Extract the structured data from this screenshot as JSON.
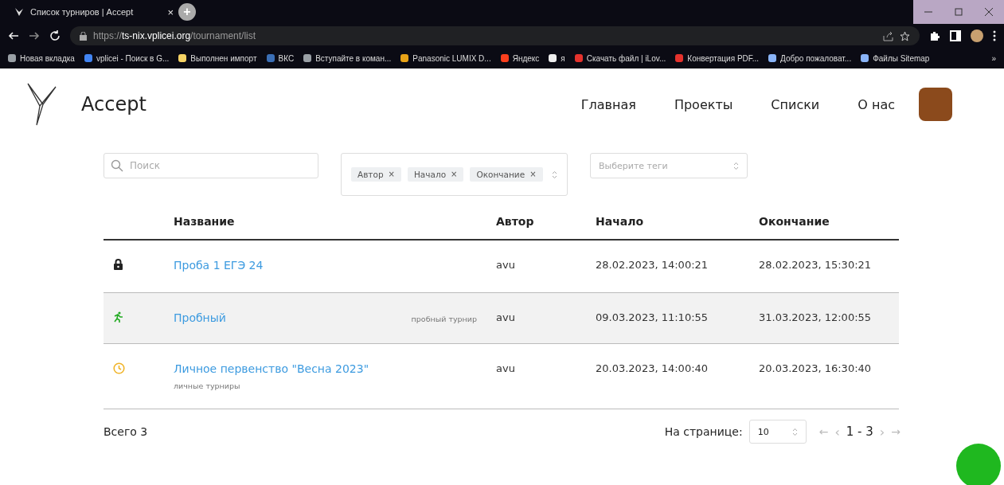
{
  "browser": {
    "tab_title": "Список турниров | Accept",
    "tab_close": "×",
    "new_tab": "+",
    "url_scheme": "https://",
    "url_host": "ts-nix.vplicei.org",
    "url_path": "/tournament/list",
    "bookmarks": [
      {
        "label": "Новая вкладка",
        "color": "#9aa0a6"
      },
      {
        "label": "vplicei - Поиск в G...",
        "color": "#4285f4"
      },
      {
        "label": "Выполнен импорт",
        "color": "#f6d365"
      },
      {
        "label": "ВКС",
        "color": "#3b6fb6"
      },
      {
        "label": "Вступайте в коман...",
        "color": "#9aa0a6"
      },
      {
        "label": "Panasonic LUMIX D...",
        "color": "#e8a317"
      },
      {
        "label": "Яндекс",
        "color": "#fc3f1d"
      },
      {
        "label": "я",
        "color": "#eeeeee"
      },
      {
        "label": "Скачать файл | iLov...",
        "color": "#e5322d"
      },
      {
        "label": "Конвертация PDF...",
        "color": "#e5322d"
      },
      {
        "label": "Добро пожаловат...",
        "color": "#8ab4f8"
      },
      {
        "label": "Файлы Sitemap",
        "color": "#8ab4f8"
      }
    ],
    "more": "»"
  },
  "header": {
    "brand": "Accept",
    "nav": [
      {
        "label": "Главная"
      },
      {
        "label": "Проекты"
      },
      {
        "label": "Списки"
      },
      {
        "label": "О нас"
      }
    ]
  },
  "filters": {
    "search_placeholder": "Поиск",
    "columns": [
      {
        "label": "Автор",
        "remove": "×"
      },
      {
        "label": "Начало",
        "remove": "×"
      },
      {
        "label": "Окончание",
        "remove": "×"
      }
    ],
    "tags_placeholder": "Выберите теги"
  },
  "table": {
    "columns": [
      "Название",
      "Автор",
      "Начало",
      "Окончание"
    ],
    "rows": [
      {
        "kind": "lock",
        "color": "#222222",
        "name": "Проба 1 ЕГЭ 24",
        "author": "avu",
        "start": "28.02.2023, 14:00:21",
        "end": "28.02.2023, 15:30:21",
        "selected": false
      },
      {
        "kind": "running",
        "color": "#22aa22",
        "name": "Пробный",
        "tag": "пробный турнир",
        "author": "avu",
        "start": "09.03.2023, 11:10:55",
        "end": "31.03.2023, 12:00:55",
        "selected": true
      },
      {
        "kind": "clock",
        "color": "#f0b429",
        "name": "Личное первенство \"Весна 2023\"",
        "tag_below": "личные турниры",
        "author": "avu",
        "start": "20.03.2023, 14:00:40",
        "end": "20.03.2023, 16:30:40",
        "selected": false
      }
    ]
  },
  "footer": {
    "total": "Всего 3",
    "per_page_label": "На странице:",
    "per_page": "10",
    "first": "←",
    "prev": "‹",
    "range": "1 - 3",
    "next": "›",
    "last": "→"
  }
}
